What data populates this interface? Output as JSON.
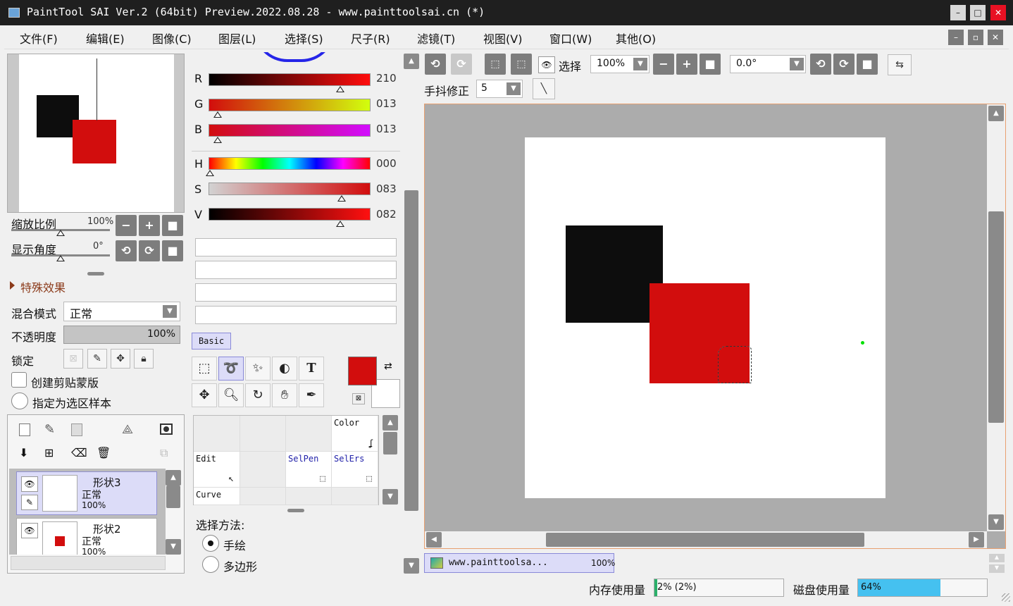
{
  "window": {
    "title": "PaintTool SAI Ver.2 (64bit) Preview.2022.08.28 - www.painttoolsai.cn (*)"
  },
  "menu": [
    "文件(F)",
    "编辑(E)",
    "图像(C)",
    "图层(L)",
    "选择(S)",
    "尺子(R)",
    "滤镜(T)",
    "视图(V)",
    "窗口(W)",
    "其他(O)"
  ],
  "navigator": {
    "zoom_label": "缩放比例",
    "zoom_value": "100%",
    "angle_label": "显示角度",
    "angle_value": "0°",
    "effects_label": "特殊效果"
  },
  "layer_props": {
    "blend_label": "混合模式",
    "blend_value": "正常",
    "opacity_label": "不透明度",
    "opacity_value": "100%",
    "opacity_fraction": 1.0,
    "lock_label": "锁定",
    "clip_label": "创建剪贴蒙版",
    "sample_label": "指定为选区样本"
  },
  "layers": [
    {
      "name": "形状3",
      "mode": "正常",
      "opacity": "100%",
      "selected": true
    },
    {
      "name": "形状2",
      "mode": "正常",
      "opacity": "100%",
      "selected": false
    }
  ],
  "color": {
    "R": {
      "label": "R",
      "value": "210"
    },
    "G": {
      "label": "G",
      "value": "013"
    },
    "B": {
      "label": "B",
      "value": "013"
    },
    "H": {
      "label": "H",
      "value": "000"
    },
    "S": {
      "label": "S",
      "value": "083"
    },
    "V": {
      "label": "V",
      "value": "082"
    },
    "primary": "#d20d0d",
    "secondary": "#ffffff"
  },
  "toolset": {
    "tab_label": "Basic",
    "cells": {
      "color": "Color",
      "edit": "Edit",
      "selpen": "SelPen",
      "selers": "SelErs",
      "curve": "Curve"
    }
  },
  "select_method": {
    "label": "选择方法:",
    "options": [
      "手绘",
      "多边形"
    ],
    "selected": 0
  },
  "toolbar": {
    "select_label": "选择",
    "zoom_value": "100%",
    "angle_value": "0.0°",
    "stabilizer_label": "手抖修正",
    "stabilizer_value": "5"
  },
  "canvas": {
    "bg": "#ffffff",
    "black_rect": "#0d0d0d",
    "red_rect": "#d20d0d",
    "dot_color": "#00e000"
  },
  "tab": {
    "name": "www.painttoolsa...",
    "zoom": "100%"
  },
  "status": {
    "mem_label": "内存使用量",
    "mem_value": "2% (2%)",
    "mem_fraction": 0.02,
    "disk_label": "磁盘使用量",
    "disk_value": "64%",
    "disk_fraction": 0.64
  }
}
